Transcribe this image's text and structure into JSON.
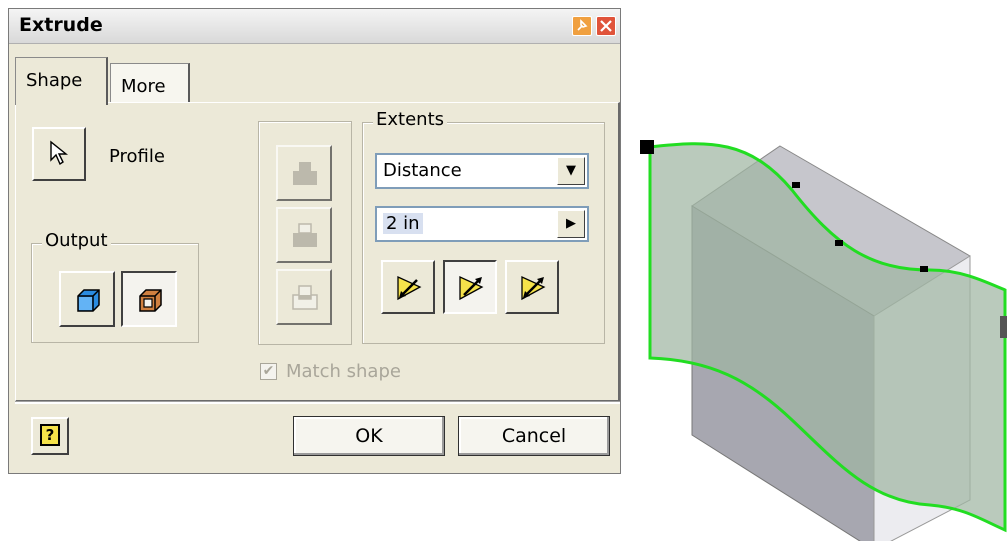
{
  "dialog": {
    "title": "Extrude",
    "tabs": [
      {
        "label": "Shape",
        "active": true
      },
      {
        "label": "More",
        "active": false
      }
    ],
    "profile_label": "Profile",
    "output_label": "Output",
    "extents": {
      "label": "Extents",
      "type_value": "Distance",
      "distance_value": "2 in"
    },
    "match_shape_label": "Match shape",
    "match_shape_checked": true,
    "ok_label": "OK",
    "cancel_label": "Cancel",
    "help_glyph": "?"
  },
  "colors": {
    "dialog_bg": "#ece9d8",
    "close_button": "#e0533a",
    "pin_button": "#f0a040",
    "solid_blue": "#2a8be0",
    "surface_orange": "#d08040",
    "direction_yellow": "#f5e24a",
    "profile_green": "#22dd22",
    "surface_fill": "#9fb6a2",
    "block_gray": "#a7a7b0"
  },
  "icons": [
    "pin-icon",
    "close-icon",
    "cursor-arrow-icon",
    "solid-output-icon",
    "surface-output-icon",
    "join-icon",
    "cut-icon",
    "intersect-icon",
    "dropdown-arrow-icon",
    "expand-arrow-icon",
    "direction-1-icon",
    "direction-2-icon",
    "symmetric-icon",
    "help-icon"
  ]
}
